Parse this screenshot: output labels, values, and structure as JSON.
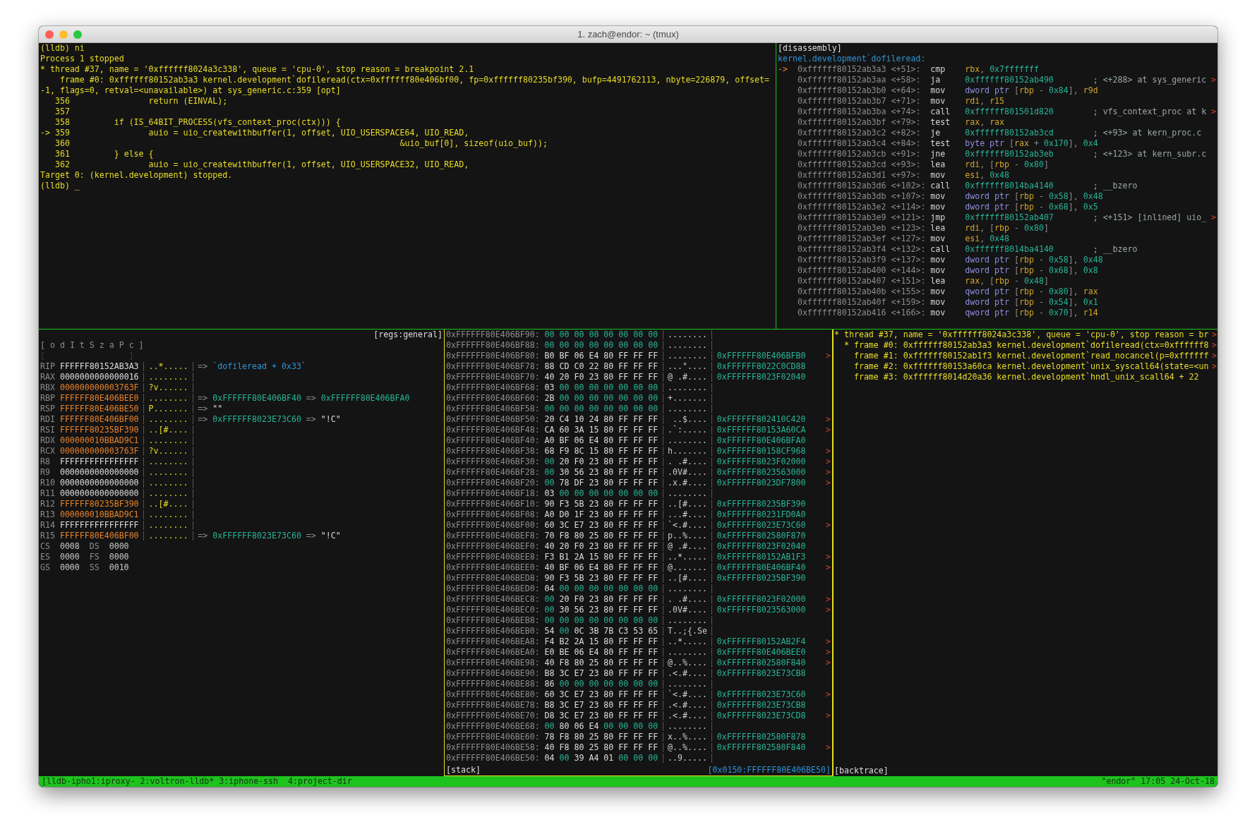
{
  "window": {
    "title": "1. zach@endor: ~ (tmux)"
  },
  "console": {
    "lines": [
      "(lldb) ni",
      "Process 1 stopped",
      "* thread #37, name = '0xffffff8024a3c338', queue = 'cpu-0', stop reason = breakpoint 2.1",
      "    frame #0: 0xffffff80152ab3a3 kernel.development`dofileread(ctx=0xffffff80e406bf00, fp=0xffffff80235bf390, bufp=4491762113, nbyte=226879, offset=",
      "-1, flags=0, retval=<unavailable>) at sys_generic.c:359 [opt]",
      "   356                return (EINVAL);",
      "   357",
      "   358         if (IS_64BIT_PROCESS(vfs_context_proc(ctx))) {",
      "-> 359                auio = uio_createwithbuffer(1, offset, UIO_USERSPACE64, UIO_READ,",
      "   360                                                                   &uio_buf[0], sizeof(uio_buf));",
      "   361         } else {",
      "   362                auio = uio_createwithbuffer(1, offset, UIO_USERSPACE32, UIO_READ,",
      "Target 0: (kernel.development) stopped.",
      "(lldb) _"
    ]
  },
  "disassembly": {
    "title": "[disassembly]",
    "function": "kernel.development`dofileread:",
    "rows": [
      {
        "marker": "->",
        "address": "0xffffff80152ab3a3",
        "offset": "<+51>:",
        "mnemonic": "cmp",
        "operands": [
          {
            "text": "rbx",
            "kind": "reg"
          },
          {
            "text": ", ",
            "kind": "punct"
          },
          {
            "text": "0x7fffffff",
            "kind": "imm"
          }
        ]
      },
      {
        "address": "0xffffff80152ab3aa",
        "offset": "<+58>:",
        "mnemonic": "ja",
        "operands": [
          {
            "text": "0xffffff80152ab490",
            "kind": "imm"
          }
        ],
        "comment": "; <+288> at sys_generic",
        "overflow_mark": ">"
      },
      {
        "address": "0xffffff80152ab3b0",
        "offset": "<+64>:",
        "mnemonic": "mov",
        "operands": [
          {
            "text": "dword ptr",
            "kind": "size"
          },
          {
            "text": " [",
            "kind": "punct"
          },
          {
            "text": "rbp",
            "kind": "reg"
          },
          {
            "text": " - ",
            "kind": "punct"
          },
          {
            "text": "0x84",
            "kind": "imm"
          },
          {
            "text": "], ",
            "kind": "punct"
          },
          {
            "text": "r9d",
            "kind": "reg"
          }
        ]
      },
      {
        "address": "0xffffff80152ab3b7",
        "offset": "<+71>:",
        "mnemonic": "mov",
        "operands": [
          {
            "text": "rdi",
            "kind": "reg"
          },
          {
            "text": ", ",
            "kind": "punct"
          },
          {
            "text": "r15",
            "kind": "reg"
          }
        ]
      },
      {
        "address": "0xffffff80152ab3ba",
        "offset": "<+74>:",
        "mnemonic": "call",
        "operands": [
          {
            "text": "0xffffff801501d820",
            "kind": "imm"
          }
        ],
        "comment": "; vfs_context_proc at k",
        "overflow_mark": ">"
      },
      {
        "address": "0xffffff80152ab3bf",
        "offset": "<+79>:",
        "mnemonic": "test",
        "operands": [
          {
            "text": "rax",
            "kind": "reg"
          },
          {
            "text": ", ",
            "kind": "punct"
          },
          {
            "text": "rax",
            "kind": "reg"
          }
        ]
      },
      {
        "address": "0xffffff80152ab3c2",
        "offset": "<+82>:",
        "mnemonic": "je",
        "operands": [
          {
            "text": "0xffffff80152ab3cd",
            "kind": "imm"
          }
        ],
        "comment": "; <+93> at kern_proc.c"
      },
      {
        "address": "0xffffff80152ab3c4",
        "offset": "<+84>:",
        "mnemonic": "test",
        "operands": [
          {
            "text": "byte ptr",
            "kind": "size"
          },
          {
            "text": " [",
            "kind": "punct"
          },
          {
            "text": "rax",
            "kind": "reg"
          },
          {
            "text": " + ",
            "kind": "punct"
          },
          {
            "text": "0x170",
            "kind": "imm"
          },
          {
            "text": "], ",
            "kind": "punct"
          },
          {
            "text": "0x4",
            "kind": "imm"
          }
        ]
      },
      {
        "address": "0xffffff80152ab3cb",
        "offset": "<+91>:",
        "mnemonic": "jne",
        "operands": [
          {
            "text": "0xffffff80152ab3eb",
            "kind": "imm"
          }
        ],
        "comment": "; <+123> at kern_subr.c"
      },
      {
        "address": "0xffffff80152ab3cd",
        "offset": "<+93>:",
        "mnemonic": "lea",
        "operands": [
          {
            "text": "rdi",
            "kind": "reg"
          },
          {
            "text": ", [",
            "kind": "punct"
          },
          {
            "text": "rbp",
            "kind": "reg"
          },
          {
            "text": " - ",
            "kind": "punct"
          },
          {
            "text": "0x80",
            "kind": "imm"
          },
          {
            "text": "]",
            "kind": "punct"
          }
        ]
      },
      {
        "address": "0xffffff80152ab3d1",
        "offset": "<+97>:",
        "mnemonic": "mov",
        "operands": [
          {
            "text": "esi",
            "kind": "reg"
          },
          {
            "text": ", ",
            "kind": "punct"
          },
          {
            "text": "0x48",
            "kind": "imm"
          }
        ]
      },
      {
        "address": "0xffffff80152ab3d6",
        "offset": "<+102>:",
        "mnemonic": "call",
        "operands": [
          {
            "text": "0xffffff8014ba4140",
            "kind": "imm"
          }
        ],
        "comment": "; __bzero"
      },
      {
        "address": "0xffffff80152ab3db",
        "offset": "<+107>:",
        "mnemonic": "mov",
        "operands": [
          {
            "text": "dword ptr",
            "kind": "size"
          },
          {
            "text": " [",
            "kind": "punct"
          },
          {
            "text": "rbp",
            "kind": "reg"
          },
          {
            "text": " - ",
            "kind": "punct"
          },
          {
            "text": "0x58",
            "kind": "imm"
          },
          {
            "text": "], ",
            "kind": "punct"
          },
          {
            "text": "0x48",
            "kind": "imm"
          }
        ]
      },
      {
        "address": "0xffffff80152ab3e2",
        "offset": "<+114>:",
        "mnemonic": "mov",
        "operands": [
          {
            "text": "dword ptr",
            "kind": "size"
          },
          {
            "text": " [",
            "kind": "punct"
          },
          {
            "text": "rbp",
            "kind": "reg"
          },
          {
            "text": " - ",
            "kind": "punct"
          },
          {
            "text": "0x68",
            "kind": "imm"
          },
          {
            "text": "], ",
            "kind": "punct"
          },
          {
            "text": "0x5",
            "kind": "imm"
          }
        ]
      },
      {
        "address": "0xffffff80152ab3e9",
        "offset": "<+121>:",
        "mnemonic": "jmp",
        "operands": [
          {
            "text": "0xffffff80152ab407",
            "kind": "imm"
          }
        ],
        "comment": "; <+151> [inlined] uio_",
        "overflow_mark": ">"
      },
      {
        "address": "0xffffff80152ab3eb",
        "offset": "<+123>:",
        "mnemonic": "lea",
        "operands": [
          {
            "text": "rdi",
            "kind": "reg"
          },
          {
            "text": ", [",
            "kind": "punct"
          },
          {
            "text": "rbp",
            "kind": "reg"
          },
          {
            "text": " - ",
            "kind": "punct"
          },
          {
            "text": "0x80",
            "kind": "imm"
          },
          {
            "text": "]",
            "kind": "punct"
          }
        ]
      },
      {
        "address": "0xffffff80152ab3ef",
        "offset": "<+127>:",
        "mnemonic": "mov",
        "operands": [
          {
            "text": "esi",
            "kind": "reg"
          },
          {
            "text": ", ",
            "kind": "punct"
          },
          {
            "text": "0x48",
            "kind": "imm"
          }
        ]
      },
      {
        "address": "0xffffff80152ab3f4",
        "offset": "<+132>:",
        "mnemonic": "call",
        "operands": [
          {
            "text": "0xffffff8014ba4140",
            "kind": "imm"
          }
        ],
        "comment": "; __bzero"
      },
      {
        "address": "0xffffff80152ab3f9",
        "offset": "<+137>:",
        "mnemonic": "mov",
        "operands": [
          {
            "text": "dword ptr",
            "kind": "size"
          },
          {
            "text": " [",
            "kind": "punct"
          },
          {
            "text": "rbp",
            "kind": "reg"
          },
          {
            "text": " - ",
            "kind": "punct"
          },
          {
            "text": "0x58",
            "kind": "imm"
          },
          {
            "text": "], ",
            "kind": "punct"
          },
          {
            "text": "0x48",
            "kind": "imm"
          }
        ]
      },
      {
        "address": "0xffffff80152ab400",
        "offset": "<+144>:",
        "mnemonic": "mov",
        "operands": [
          {
            "text": "dword ptr",
            "kind": "size"
          },
          {
            "text": " [",
            "kind": "punct"
          },
          {
            "text": "rbp",
            "kind": "reg"
          },
          {
            "text": " - ",
            "kind": "punct"
          },
          {
            "text": "0x68",
            "kind": "imm"
          },
          {
            "text": "], ",
            "kind": "punct"
          },
          {
            "text": "0x8",
            "kind": "imm"
          }
        ]
      },
      {
        "address": "0xffffff80152ab407",
        "offset": "<+151>:",
        "mnemonic": "lea",
        "operands": [
          {
            "text": "rax",
            "kind": "reg"
          },
          {
            "text": ", [",
            "kind": "punct"
          },
          {
            "text": "rbp",
            "kind": "reg"
          },
          {
            "text": " - ",
            "kind": "punct"
          },
          {
            "text": "0x48",
            "kind": "imm"
          },
          {
            "text": "]",
            "kind": "punct"
          }
        ]
      },
      {
        "address": "0xffffff80152ab40b",
        "offset": "<+155>:",
        "mnemonic": "mov",
        "operands": [
          {
            "text": "qword ptr",
            "kind": "size"
          },
          {
            "text": " [",
            "kind": "punct"
          },
          {
            "text": "rbp",
            "kind": "reg"
          },
          {
            "text": " - ",
            "kind": "punct"
          },
          {
            "text": "0x80",
            "kind": "imm"
          },
          {
            "text": "], ",
            "kind": "punct"
          },
          {
            "text": "rax",
            "kind": "reg"
          }
        ]
      },
      {
        "address": "0xffffff80152ab40f",
        "offset": "<+159>:",
        "mnemonic": "mov",
        "operands": [
          {
            "text": "dword ptr",
            "kind": "size"
          },
          {
            "text": " [",
            "kind": "punct"
          },
          {
            "text": "rbp",
            "kind": "reg"
          },
          {
            "text": " - ",
            "kind": "punct"
          },
          {
            "text": "0x54",
            "kind": "imm"
          },
          {
            "text": "], ",
            "kind": "punct"
          },
          {
            "text": "0x1",
            "kind": "imm"
          }
        ]
      },
      {
        "address": "0xffffff80152ab416",
        "offset": "<+166>:",
        "mnemonic": "mov",
        "operands": [
          {
            "text": "qword ptr",
            "kind": "size"
          },
          {
            "text": " [",
            "kind": "punct"
          },
          {
            "text": "rbp",
            "kind": "reg"
          },
          {
            "text": " - ",
            "kind": "punct"
          },
          {
            "text": "0x70",
            "kind": "imm"
          },
          {
            "text": "], ",
            "kind": "punct"
          },
          {
            "text": "r14",
            "kind": "reg"
          }
        ]
      }
    ]
  },
  "registers": {
    "title": "[regs:general]",
    "flags": "[ o d I t S z a P c ]",
    "flags_previous": "[                 ]",
    "rows": [
      {
        "name": "RIP",
        "value": "FFFFFF80152AB3A3",
        "changed": false,
        "ascii": "..*.....",
        "deref": [
          {
            "text": "=>",
            "kind": "arrow"
          },
          {
            "text": "`dofileread + 0x33`",
            "kind": "symbol"
          }
        ]
      },
      {
        "name": "RAX",
        "value": "0000000000000016",
        "changed": false,
        "ascii": "........"
      },
      {
        "name": "RBX",
        "value": "000000000003763F",
        "changed": true,
        "ascii": "?v......"
      },
      {
        "name": "RBP",
        "value": "FFFFFF80E406BEE0",
        "changed": true,
        "ascii": "........",
        "deref": [
          {
            "text": "=>",
            "kind": "arrow"
          },
          {
            "text": "0xFFFFFF80E406BF40",
            "kind": "address"
          },
          {
            "text": "=>",
            "kind": "arrow"
          },
          {
            "text": "0xFFFFFF80E406BFA0",
            "kind": "address"
          }
        ]
      },
      {
        "name": "RSP",
        "value": "FFFFFF80E406BE50",
        "changed": true,
        "ascii": "P.......",
        "deref": [
          {
            "text": "=>",
            "kind": "arrow"
          },
          {
            "text": "\"\"",
            "kind": "string"
          }
        ]
      },
      {
        "name": "RDI",
        "value": "FFFFFF80E406BF00",
        "changed": true,
        "ascii": "........",
        "deref": [
          {
            "text": "=>",
            "kind": "arrow"
          },
          {
            "text": "0xFFFFFF8023E73C60",
            "kind": "address"
          },
          {
            "text": "=>",
            "kind": "arrow"
          },
          {
            "text": "\"!C\"",
            "kind": "string"
          }
        ]
      },
      {
        "name": "RSI",
        "value": "FFFFFF80235BF390",
        "changed": true,
        "ascii": "..[#...."
      },
      {
        "name": "RDX",
        "value": "000000010BBAD9C1",
        "changed": true,
        "ascii": "........"
      },
      {
        "name": "RCX",
        "value": "000000000003763F",
        "changed": true,
        "ascii": "?v......"
      },
      {
        "name": "R8",
        "value": "FFFFFFFFFFFFFFFF",
        "changed": false,
        "ascii": "........"
      },
      {
        "name": "R9",
        "value": "0000000000000000",
        "changed": false,
        "ascii": "........"
      },
      {
        "name": "R10",
        "value": "0000000000000000",
        "changed": false,
        "ascii": "........"
      },
      {
        "name": "R11",
        "value": "0000000000000000",
        "changed": false,
        "ascii": "........"
      },
      {
        "name": "R12",
        "value": "FFFFFF80235BF390",
        "changed": true,
        "ascii": "..[#...."
      },
      {
        "name": "R13",
        "value": "000000010BBAD9C1",
        "changed": true,
        "ascii": "........"
      },
      {
        "name": "R14",
        "value": "FFFFFFFFFFFFFFFF",
        "changed": false,
        "ascii": "........"
      },
      {
        "name": "R15",
        "value": "FFFFFF80E406BF00",
        "changed": true,
        "ascii": "........",
        "deref": [
          {
            "text": "=>",
            "kind": "arrow"
          },
          {
            "text": "0xFFFFFF8023E73C60",
            "kind": "address"
          },
          {
            "text": "=>",
            "kind": "arrow"
          },
          {
            "text": "\"!C\"",
            "kind": "string"
          }
        ]
      }
    ],
    "segments": [
      [
        {
          "name": "CS",
          "value": "0008"
        },
        {
          "name": "DS",
          "value": "0000"
        }
      ],
      [
        {
          "name": "ES",
          "value": "0000"
        },
        {
          "name": "FS",
          "value": "0000"
        }
      ],
      [
        {
          "name": "GS",
          "value": "0000"
        },
        {
          "name": "SS",
          "value": "0010"
        }
      ]
    ]
  },
  "stack": {
    "title": "[stack]",
    "position": "[0x0150:FFFFFF80E406BE50]",
    "rows": [
      {
        "address": "0xFFFFFF80E406BF90:",
        "bytes": [
          {
            "text": "00 00 00 00 00 00 00 00",
            "zero": true
          }
        ],
        "ascii": "........"
      },
      {
        "address": "0xFFFFFF80E406BF88:",
        "bytes": [
          {
            "text": "00 00 00 00 00 00 00 00",
            "zero": true
          }
        ],
        "ascii": "........"
      },
      {
        "address": "0xFFFFFF80E406BF80:",
        "bytes": [
          {
            "text": "B0 BF 06 E4 80 FF FF FF",
            "zero": false
          }
        ],
        "ascii": "........",
        "pointer": "0xFFFFFF80E406BFB0",
        "overflow_mark": ">"
      },
      {
        "address": "0xFFFFFF80E406BF78:",
        "bytes": [
          {
            "text": "88 CD C0 22 80 FF FF FF",
            "zero": false
          }
        ],
        "ascii": "...\"....",
        "pointer": "0xFFFFFF8022C0CD88"
      },
      {
        "address": "0xFFFFFF80E406BF70:",
        "bytes": [
          {
            "text": "40 20 F0 23 80 FF FF FF",
            "zero": false
          }
        ],
        "ascii": "@ .#....",
        "pointer": "0xFFFFFF8023F02040"
      },
      {
        "address": "0xFFFFFF80E406BF68:",
        "bytes": [
          {
            "text": "03",
            "zero": false
          },
          {
            "text": "00 00 00 00 00 00 00",
            "zero": true
          }
        ],
        "ascii": "........"
      },
      {
        "address": "0xFFFFFF80E406BF60:",
        "bytes": [
          {
            "text": "2B",
            "zero": false
          },
          {
            "text": "00 00 00 00 00 00 00",
            "zero": true
          }
        ],
        "ascii": "+......."
      },
      {
        "address": "0xFFFFFF80E406BF58:",
        "bytes": [
          {
            "text": "00 00 00 00 00 00 00 00",
            "zero": true
          }
        ],
        "ascii": "........"
      },
      {
        "address": "0xFFFFFF80E406BF50:",
        "bytes": [
          {
            "text": "20 C4 10 24 80 FF FF FF",
            "zero": false
          }
        ],
        "ascii": " ..$....",
        "pointer": "0xFFFFFF802410C420",
        "overflow_mark": ">"
      },
      {
        "address": "0xFFFFFF80E406BF48:",
        "bytes": [
          {
            "text": "CA 60 3A 15 80 FF FF FF",
            "zero": false
          }
        ],
        "ascii": ".`:.....",
        "pointer": "0xFFFFFF80153A60CA",
        "overflow_mark": ">"
      },
      {
        "address": "0xFFFFFF80E406BF40:",
        "bytes": [
          {
            "text": "A0 BF 06 E4 80 FF FF FF",
            "zero": false
          }
        ],
        "ascii": "........",
        "pointer": "0xFFFFFF80E406BFA0"
      },
      {
        "address": "0xFFFFFF80E406BF38:",
        "bytes": [
          {
            "text": "68 F9 8C 15 80 FF FF FF",
            "zero": false
          }
        ],
        "ascii": "h.......",
        "pointer": "0xFFFFFF80158CF968",
        "overflow_mark": ">"
      },
      {
        "address": "0xFFFFFF80E406BF30:",
        "bytes": [
          {
            "text": "00",
            "zero": true
          },
          {
            "text": "20 F0 23 80 FF FF FF",
            "zero": false
          }
        ],
        "ascii": ". .#....",
        "pointer": "0xFFFFFF8023F02000",
        "overflow_mark": ">"
      },
      {
        "address": "0xFFFFFF80E406BF28:",
        "bytes": [
          {
            "text": "00",
            "zero": true
          },
          {
            "text": "30 56 23 80 FF FF FF",
            "zero": false
          }
        ],
        "ascii": ".0V#....",
        "pointer": "0xFFFFFF8023563000",
        "overflow_mark": ">"
      },
      {
        "address": "0xFFFFFF80E406BF20:",
        "bytes": [
          {
            "text": "00",
            "zero": true
          },
          {
            "text": "78 DF 23 80 FF FF FF",
            "zero": false
          }
        ],
        "ascii": ".x.#....",
        "pointer": "0xFFFFFF8023DF7800",
        "overflow_mark": ">"
      },
      {
        "address": "0xFFFFFF80E406BF18:",
        "bytes": [
          {
            "text": "03",
            "zero": false
          },
          {
            "text": "00 00 00 00 00 00 00",
            "zero": true
          }
        ],
        "ascii": "........"
      },
      {
        "address": "0xFFFFFF80E406BF10:",
        "bytes": [
          {
            "text": "90 F3 5B 23 80 FF FF FF",
            "zero": false
          }
        ],
        "ascii": "..[#....",
        "pointer": "0xFFFFFF80235BF390"
      },
      {
        "address": "0xFFFFFF80E406BF08:",
        "bytes": [
          {
            "text": "A0 D0 1F 23 80 FF FF FF",
            "zero": false
          }
        ],
        "ascii": "...#....",
        "pointer": "0xFFFFFF80231FD0A0"
      },
      {
        "address": "0xFFFFFF80E406BF00:",
        "bytes": [
          {
            "text": "60 3C E7 23 80 FF FF FF",
            "zero": false
          }
        ],
        "ascii": "`<.#....",
        "pointer": "0xFFFFFF8023E73C60",
        "overflow_mark": ">"
      },
      {
        "address": "0xFFFFFF80E406BEF8:",
        "bytes": [
          {
            "text": "70 F8 80 25 80 FF FF FF",
            "zero": false
          }
        ],
        "ascii": "p..%....",
        "pointer": "0xFFFFFF802580F870"
      },
      {
        "address": "0xFFFFFF80E406BEF0:",
        "bytes": [
          {
            "text": "40 20 F0 23 80 FF FF FF",
            "zero": false
          }
        ],
        "ascii": "@ .#....",
        "pointer": "0xFFFFFF8023F02040"
      },
      {
        "address": "0xFFFFFF80E406BEE8:",
        "bytes": [
          {
            "text": "F3 B1 2A 15 80 FF FF FF",
            "zero": false
          }
        ],
        "ascii": "..*.....",
        "pointer": "0xFFFFFF80152AB1F3",
        "overflow_mark": ">"
      },
      {
        "address": "0xFFFFFF80E406BEE0:",
        "bytes": [
          {
            "text": "40 BF 06 E4 80 FF FF FF",
            "zero": false
          }
        ],
        "ascii": "@.......",
        "pointer": "0xFFFFFF80E406BF40",
        "overflow_mark": ">"
      },
      {
        "address": "0xFFFFFF80E406BED8:",
        "bytes": [
          {
            "text": "90 F3 5B 23 80 FF FF FF",
            "zero": false
          }
        ],
        "ascii": "..[#....",
        "pointer": "0xFFFFFF80235BF390"
      },
      {
        "address": "0xFFFFFF80E406BED0:",
        "bytes": [
          {
            "text": "04",
            "zero": false
          },
          {
            "text": "00 00 00 00 00 00 00",
            "zero": true
          }
        ],
        "ascii": "........"
      },
      {
        "address": "0xFFFFFF80E406BEC8:",
        "bytes": [
          {
            "text": "00",
            "zero": true
          },
          {
            "text": "20 F0 23 80 FF FF FF",
            "zero": false
          }
        ],
        "ascii": ". .#....",
        "pointer": "0xFFFFFF8023F02000",
        "overflow_mark": ">"
      },
      {
        "address": "0xFFFFFF80E406BEC0:",
        "bytes": [
          {
            "text": "00",
            "zero": true
          },
          {
            "text": "30 56 23 80 FF FF FF",
            "zero": false
          }
        ],
        "ascii": ".0V#....",
        "pointer": "0xFFFFFF8023563000",
        "overflow_mark": ">"
      },
      {
        "address": "0xFFFFFF80E406BEB8:",
        "bytes": [
          {
            "text": "00 00 00 00 00 00 00 00",
            "zero": true
          }
        ],
        "ascii": "........"
      },
      {
        "address": "0xFFFFFF80E406BEB0:",
        "bytes": [
          {
            "text": "54",
            "zero": false
          },
          {
            "text": "00",
            "zero": true
          },
          {
            "text": "0C 3B 7B C3 53 65",
            "zero": false
          }
        ],
        "ascii": "T..;{.Se"
      },
      {
        "address": "0xFFFFFF80E406BEA8:",
        "bytes": [
          {
            "text": "F4 B2 2A 15 80 FF FF FF",
            "zero": false
          }
        ],
        "ascii": "..*.....",
        "pointer": "0xFFFFFF80152AB2F4",
        "overflow_mark": ">"
      },
      {
        "address": "0xFFFFFF80E406BEA0:",
        "bytes": [
          {
            "text": "E0 BE 06 E4 80 FF FF FF",
            "zero": false
          }
        ],
        "ascii": "........",
        "pointer": "0xFFFFFF80E406BEE0",
        "overflow_mark": ">"
      },
      {
        "address": "0xFFFFFF80E406BE98:",
        "bytes": [
          {
            "text": "40 F8 80 25 80 FF FF FF",
            "zero": false
          }
        ],
        "ascii": "@..%....",
        "pointer": "0xFFFFFF802580F840",
        "overflow_mark": ">"
      },
      {
        "address": "0xFFFFFF80E406BE90:",
        "bytes": [
          {
            "text": "B8 3C E7 23 80 FF FF FF",
            "zero": false
          }
        ],
        "ascii": ".<.#....",
        "pointer": "0xFFFFFF8023E73CB8"
      },
      {
        "address": "0xFFFFFF80E406BE88:",
        "bytes": [
          {
            "text": "86",
            "zero": false
          },
          {
            "text": "00 00 00 00 00 00 00",
            "zero": true
          }
        ],
        "ascii": "........"
      },
      {
        "address": "0xFFFFFF80E406BE80:",
        "bytes": [
          {
            "text": "60 3C E7 23 80 FF FF FF",
            "zero": false
          }
        ],
        "ascii": "`<.#....",
        "pointer": "0xFFFFFF8023E73C60",
        "overflow_mark": ">"
      },
      {
        "address": "0xFFFFFF80E406BE78:",
        "bytes": [
          {
            "text": "B8 3C E7 23 80 FF FF FF",
            "zero": false
          }
        ],
        "ascii": ".<.#....",
        "pointer": "0xFFFFFF8023E73CB8"
      },
      {
        "address": "0xFFFFFF80E406BE70:",
        "bytes": [
          {
            "text": "D8 3C E7 23 80 FF FF FF",
            "zero": false
          }
        ],
        "ascii": ".<.#....",
        "pointer": "0xFFFFFF8023E73CD8",
        "overflow_mark": ">"
      },
      {
        "address": "0xFFFFFF80E406BE68:",
        "bytes": [
          {
            "text": "00",
            "zero": true
          },
          {
            "text": "80 06 E4",
            "zero": false
          },
          {
            "text": "00 00 00 00",
            "zero": true
          }
        ],
        "ascii": "........"
      },
      {
        "address": "0xFFFFFF80E406BE60:",
        "bytes": [
          {
            "text": "78 F8 80 25 80 FF FF FF",
            "zero": false
          }
        ],
        "ascii": "x..%....",
        "pointer": "0xFFFFFF802580F878"
      },
      {
        "address": "0xFFFFFF80E406BE58:",
        "bytes": [
          {
            "text": "40 F8 80 25 80 FF FF FF",
            "zero": false
          }
        ],
        "ascii": "@..%....",
        "pointer": "0xFFFFFF802580F840",
        "overflow_mark": ">"
      },
      {
        "address": "0xFFFFFF80E406BE50:",
        "bytes": [
          {
            "text": "04",
            "zero": false
          },
          {
            "text": "00",
            "zero": true
          },
          {
            "text": "39 A4 01",
            "zero": false
          },
          {
            "text": "00 00 00",
            "zero": true
          }
        ],
        "ascii": "..9....."
      }
    ]
  },
  "backtrace": {
    "title": "[backtrace]",
    "lines": [
      {
        "text": "* thread #37, name = '0xffffff8024a3c338', queue = 'cpu-0', stop reason = br",
        "overflow_mark": ">"
      },
      {
        "text": "  * frame #0: 0xffffff80152ab3a3 kernel.development`dofileread(ctx=0xffffff8",
        "overflow_mark": ">"
      },
      {
        "text": "    frame #1: 0xffffff80152ab1f3 kernel.development`read_nocancel(p=0xffffff",
        "overflow_mark": ">"
      },
      {
        "text": "    frame #2: 0xffffff80153a60ca kernel.development`unix_syscall64(state=<un",
        "overflow_mark": ">"
      },
      {
        "text": "    frame #3: 0xffffff8014d20a36 kernel.development`hndl_unix_scall64 + 22"
      }
    ]
  },
  "status_bar": {
    "left": "[lldb-ipho1:iproxy- 2:voltron-lldb* 3:iphone-ssh  4:project-dir",
    "right": "\"endor\" 17:05 24-Oct-18"
  }
}
